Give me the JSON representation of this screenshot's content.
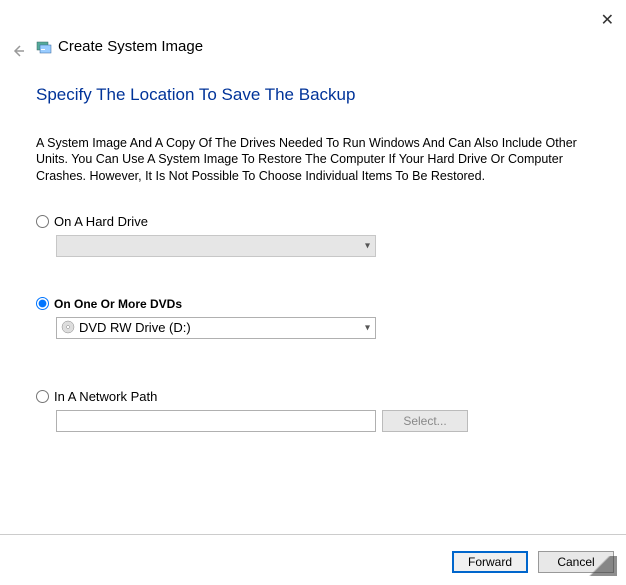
{
  "window": {
    "title": "Create System Image"
  },
  "heading": "Specify The Location To Save The Backup",
  "description": "A System Image And A Copy Of The Drives Needed To Run Windows And Can Also Include Other Units. You Can Use A System Image To Restore The Computer If Your Hard Drive Or Computer Crashes. However, It Is Not Possible To Choose Individual Items To Be Restored.",
  "options": {
    "hard_drive": {
      "label": "On A Hard Drive",
      "selected": false,
      "dropdown_value": ""
    },
    "dvds": {
      "label": "On One Or More DVDs",
      "selected": true,
      "dropdown_value": "DVD RW Drive (D:)"
    },
    "network": {
      "label": "In A Network Path",
      "selected": false,
      "path_value": "",
      "select_button": "Select..."
    }
  },
  "footer": {
    "forward": "Forward",
    "cancel": "Cancel"
  }
}
